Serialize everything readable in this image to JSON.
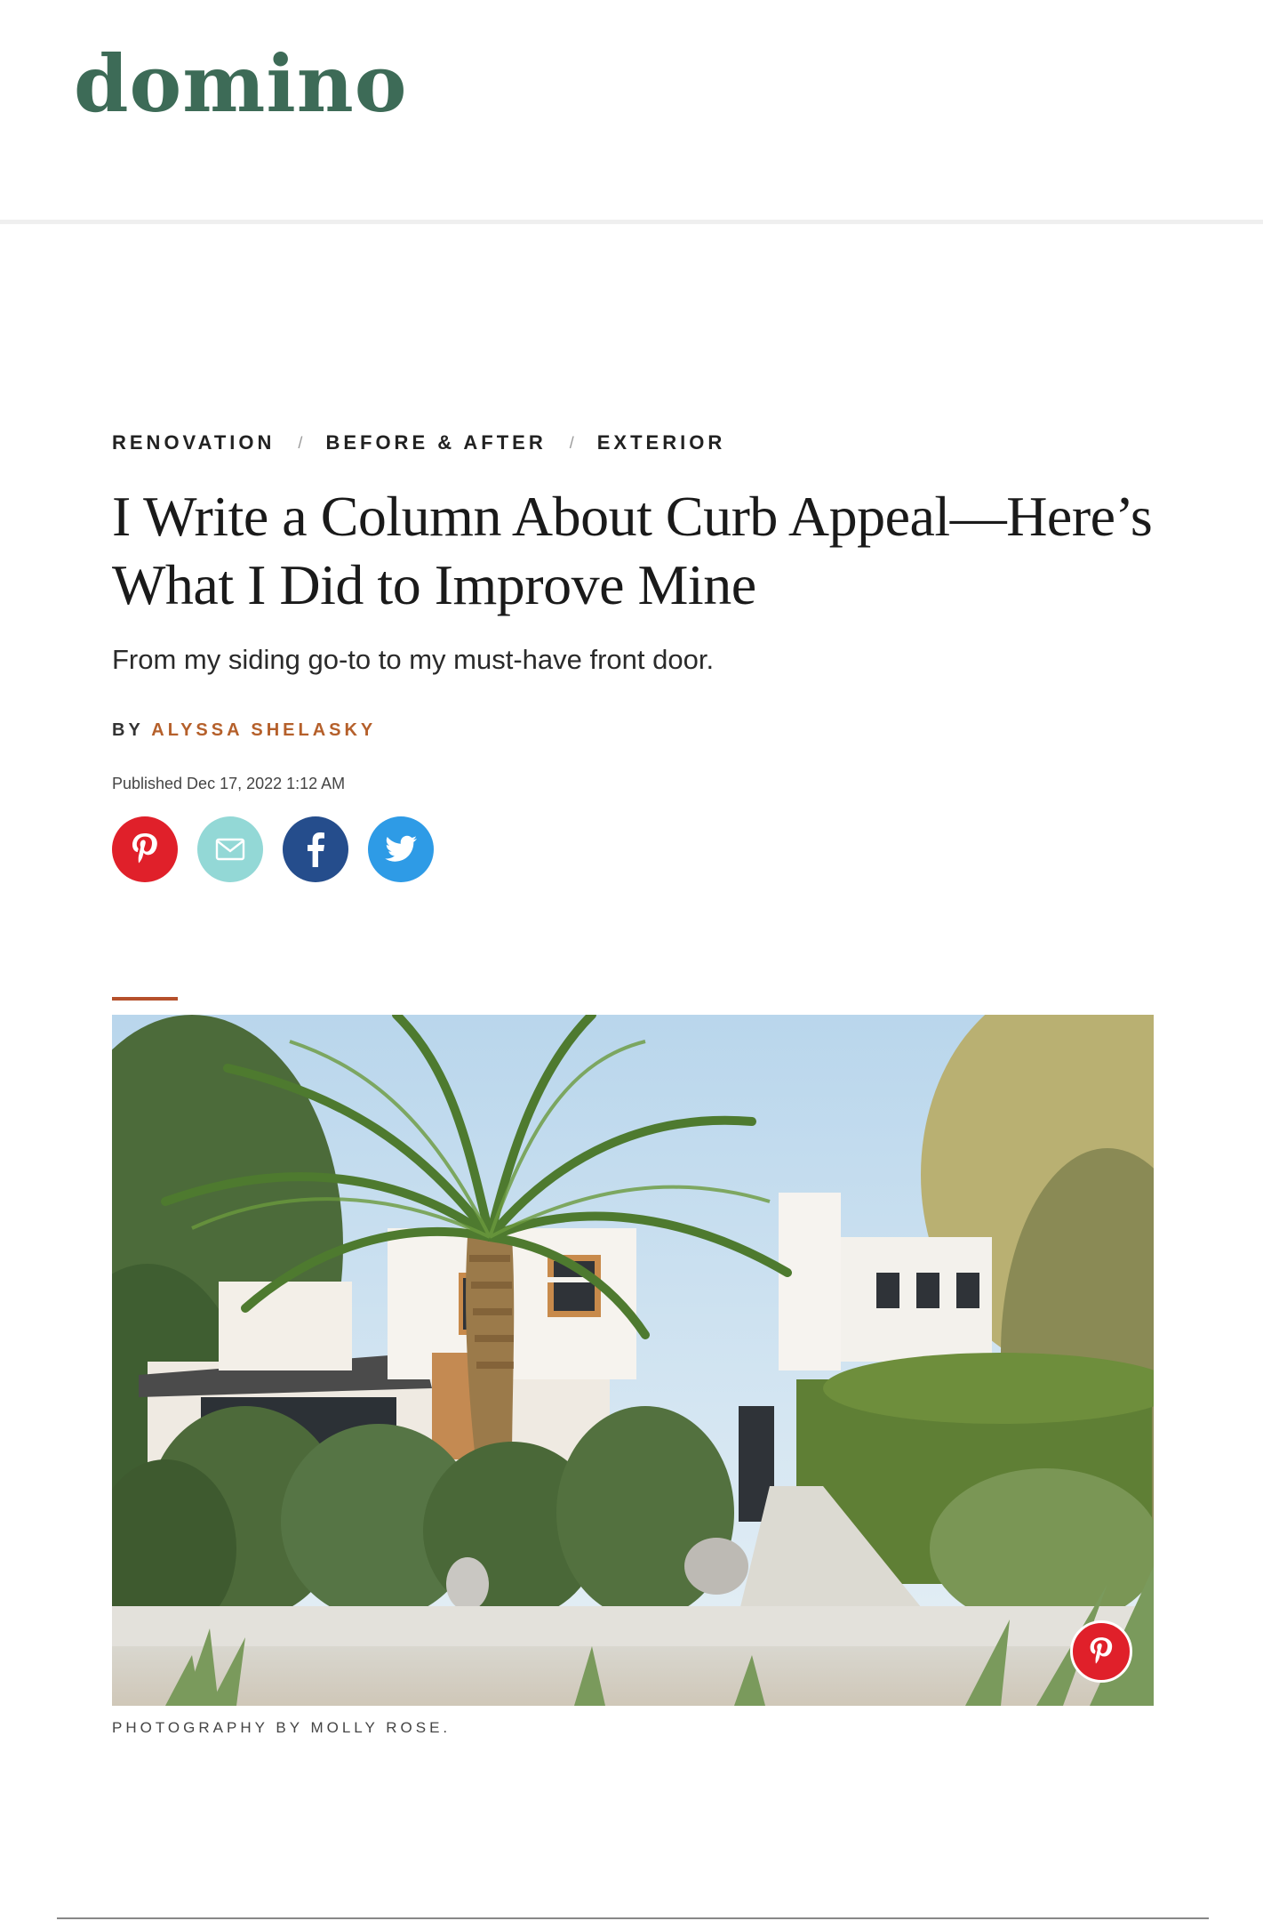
{
  "header": {
    "logo": "domino"
  },
  "article": {
    "breadcrumb": [
      "RENOVATION",
      "BEFORE & AFTER",
      "EXTERIOR"
    ],
    "breadcrumb_separator": "/",
    "headline_line1": "I Write a Column About Curb Appeal—Here’s",
    "headline_line2": "What I Did to Improve Mine",
    "dek": "From my siding go-to to my must-have front door.",
    "byline_prefix": "BY",
    "author": "ALYSSA SHELASKY",
    "published": "Published Dec 17, 2022 1:12 AM",
    "share": [
      {
        "network": "pinterest",
        "icon": "pinterest-icon",
        "color": "#e0202a"
      },
      {
        "network": "email",
        "icon": "mail-icon",
        "color": "#93d8d6"
      },
      {
        "network": "facebook",
        "icon": "facebook-icon",
        "color": "#254d8c"
      },
      {
        "network": "twitter",
        "icon": "twitter-icon",
        "color": "#2e9be6"
      }
    ],
    "hero_image": {
      "description_icon": "house-photo",
      "pin_icon": "pinterest-icon"
    },
    "caption": "PHOTOGRAPHY BY MOLLY ROSE."
  },
  "colors": {
    "brand": "#3d6b57",
    "accent": "#b5602b"
  }
}
